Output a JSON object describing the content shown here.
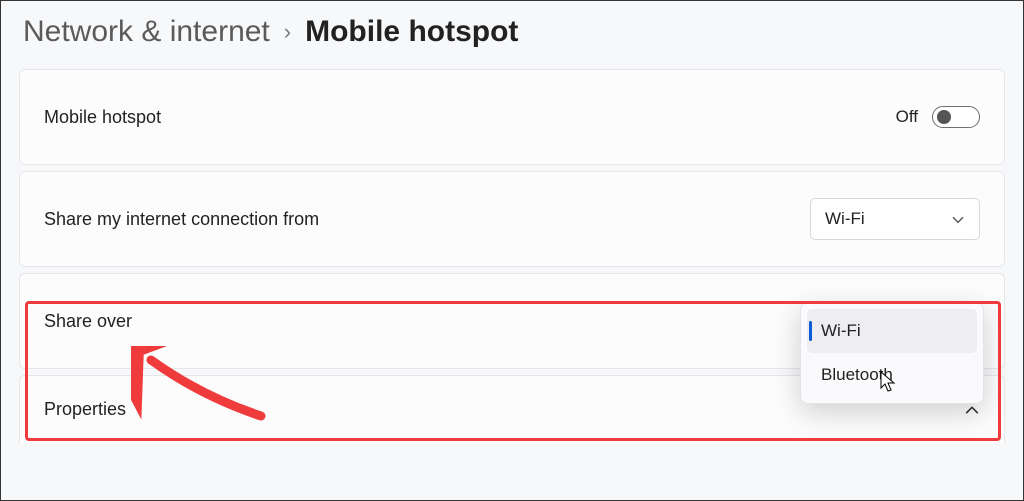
{
  "breadcrumb": {
    "parent": "Network & internet",
    "current": "Mobile hotspot"
  },
  "rows": {
    "hotspot": {
      "label": "Mobile hotspot",
      "state": "Off"
    },
    "share_from": {
      "label": "Share my internet connection from",
      "value": "Wi-Fi"
    },
    "share_over": {
      "label": "Share over",
      "options": [
        {
          "label": "Wi-Fi",
          "selected": true
        },
        {
          "label": "Bluetooth",
          "selected": false
        }
      ]
    },
    "properties": {
      "label": "Properties"
    }
  },
  "annotation": {
    "highlight_target": "share-over",
    "arrow_color": "#ef3b3b"
  }
}
